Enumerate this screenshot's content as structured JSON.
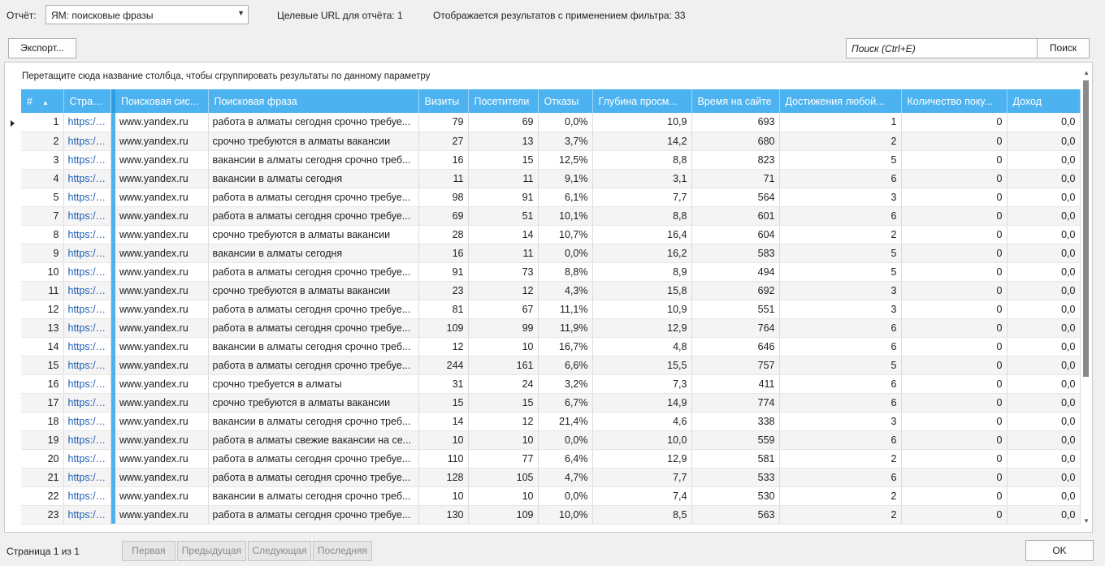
{
  "header": {
    "report_label": "Отчёт:",
    "report_value": "ЯМ: поисковые фразы",
    "urls_count": "Целевые URL для отчёта: 1",
    "results_count": "Отображается результатов с применением фильтра: 33"
  },
  "toolbar": {
    "export_label": "Экспорт...",
    "search_placeholder": "Поиск (Ctrl+E)",
    "search_label": "Поиск"
  },
  "grid": {
    "group_hint": "Перетащите сюда название столбца, чтобы сгруппировать результаты по данному параметру",
    "columns": [
      "#",
      "Стран...",
      "Поисковая сис...",
      "Поисковая фраза",
      "Визиты",
      "Посетители",
      "Отказы",
      "Глубина просм...",
      "Время на сайте",
      "Достижения любой...",
      "Количество поку...",
      "Доход"
    ],
    "rows": [
      [
        "1",
        "https://...",
        "www.yandex.ru",
        "работа в алматы сегодня срочно требуе...",
        "79",
        "69",
        "0,0%",
        "10,9",
        "693",
        "1",
        "0",
        "0,0"
      ],
      [
        "2",
        "https://...",
        "www.yandex.ru",
        "срочно требуются в алматы вакансии",
        "27",
        "13",
        "3,7%",
        "14,2",
        "680",
        "2",
        "0",
        "0,0"
      ],
      [
        "3",
        "https://...",
        "www.yandex.ru",
        "вакансии в алматы сегодня срочно треб...",
        "16",
        "15",
        "12,5%",
        "8,8",
        "823",
        "5",
        "0",
        "0,0"
      ],
      [
        "4",
        "https://...",
        "www.yandex.ru",
        "вакансии в алматы сегодня",
        "11",
        "11",
        "9,1%",
        "3,1",
        "71",
        "6",
        "0",
        "0,0"
      ],
      [
        "5",
        "https://...",
        "www.yandex.ru",
        "работа в алматы сегодня срочно требуе...",
        "98",
        "91",
        "6,1%",
        "7,7",
        "564",
        "3",
        "0",
        "0,0"
      ],
      [
        "7",
        "https://...",
        "www.yandex.ru",
        "работа в алматы сегодня срочно требуе...",
        "69",
        "51",
        "10,1%",
        "8,8",
        "601",
        "6",
        "0",
        "0,0"
      ],
      [
        "8",
        "https://...",
        "www.yandex.ru",
        "срочно требуются в алматы вакансии",
        "28",
        "14",
        "10,7%",
        "16,4",
        "604",
        "2",
        "0",
        "0,0"
      ],
      [
        "9",
        "https://...",
        "www.yandex.ru",
        "вакансии в алматы сегодня",
        "16",
        "11",
        "0,0%",
        "16,2",
        "583",
        "5",
        "0",
        "0,0"
      ],
      [
        "10",
        "https://...",
        "www.yandex.ru",
        "работа в алматы сегодня срочно требуе...",
        "91",
        "73",
        "8,8%",
        "8,9",
        "494",
        "5",
        "0",
        "0,0"
      ],
      [
        "11",
        "https://...",
        "www.yandex.ru",
        "срочно требуются в алматы вакансии",
        "23",
        "12",
        "4,3%",
        "15,8",
        "692",
        "3",
        "0",
        "0,0"
      ],
      [
        "12",
        "https://...",
        "www.yandex.ru",
        "работа в алматы сегодня срочно требуе...",
        "81",
        "67",
        "11,1%",
        "10,9",
        "551",
        "3",
        "0",
        "0,0"
      ],
      [
        "13",
        "https://...",
        "www.yandex.ru",
        "работа в алматы сегодня срочно требуе...",
        "109",
        "99",
        "11,9%",
        "12,9",
        "764",
        "6",
        "0",
        "0,0"
      ],
      [
        "14",
        "https://...",
        "www.yandex.ru",
        "вакансии в алматы сегодня срочно треб...",
        "12",
        "10",
        "16,7%",
        "4,8",
        "646",
        "6",
        "0",
        "0,0"
      ],
      [
        "15",
        "https://...",
        "www.yandex.ru",
        "работа в алматы сегодня срочно требуе...",
        "244",
        "161",
        "6,6%",
        "15,5",
        "757",
        "5",
        "0",
        "0,0"
      ],
      [
        "16",
        "https://...",
        "www.yandex.ru",
        "срочно требуется в алматы",
        "31",
        "24",
        "3,2%",
        "7,3",
        "411",
        "6",
        "0",
        "0,0"
      ],
      [
        "17",
        "https://...",
        "www.yandex.ru",
        "срочно требуются в алматы вакансии",
        "15",
        "15",
        "6,7%",
        "14,9",
        "774",
        "6",
        "0",
        "0,0"
      ],
      [
        "18",
        "https://...",
        "www.yandex.ru",
        "вакансии в алматы сегодня срочно треб...",
        "14",
        "12",
        "21,4%",
        "4,6",
        "338",
        "3",
        "0",
        "0,0"
      ],
      [
        "19",
        "https://...",
        "www.yandex.ru",
        "работа в алматы свежие вакансии на се...",
        "10",
        "10",
        "0,0%",
        "10,0",
        "559",
        "6",
        "0",
        "0,0"
      ],
      [
        "20",
        "https://...",
        "www.yandex.ru",
        "работа в алматы сегодня срочно требуе...",
        "110",
        "77",
        "6,4%",
        "12,9",
        "581",
        "2",
        "0",
        "0,0"
      ],
      [
        "21",
        "https://...",
        "www.yandex.ru",
        "работа в алматы сегодня срочно требуе...",
        "128",
        "105",
        "4,7%",
        "7,7",
        "533",
        "6",
        "0",
        "0,0"
      ],
      [
        "22",
        "https://...",
        "www.yandex.ru",
        "вакансии в алматы сегодня срочно треб...",
        "10",
        "10",
        "0,0%",
        "7,4",
        "530",
        "2",
        "0",
        "0,0"
      ],
      [
        "23",
        "https://...",
        "www.yandex.ru",
        "работа в алматы сегодня срочно требуе...",
        "130",
        "109",
        "10,0%",
        "8,5",
        "563",
        "2",
        "0",
        "0,0"
      ]
    ]
  },
  "footer": {
    "page_info": "Страница 1 из 1",
    "first_label": "Первая",
    "prev_label": "Предыдущая",
    "next_label": "Следующая",
    "last_label": "Последняя",
    "ok_label": "OK"
  },
  "colors": {
    "header_bg": "#4cb3f0",
    "link": "#1a5fb4"
  }
}
